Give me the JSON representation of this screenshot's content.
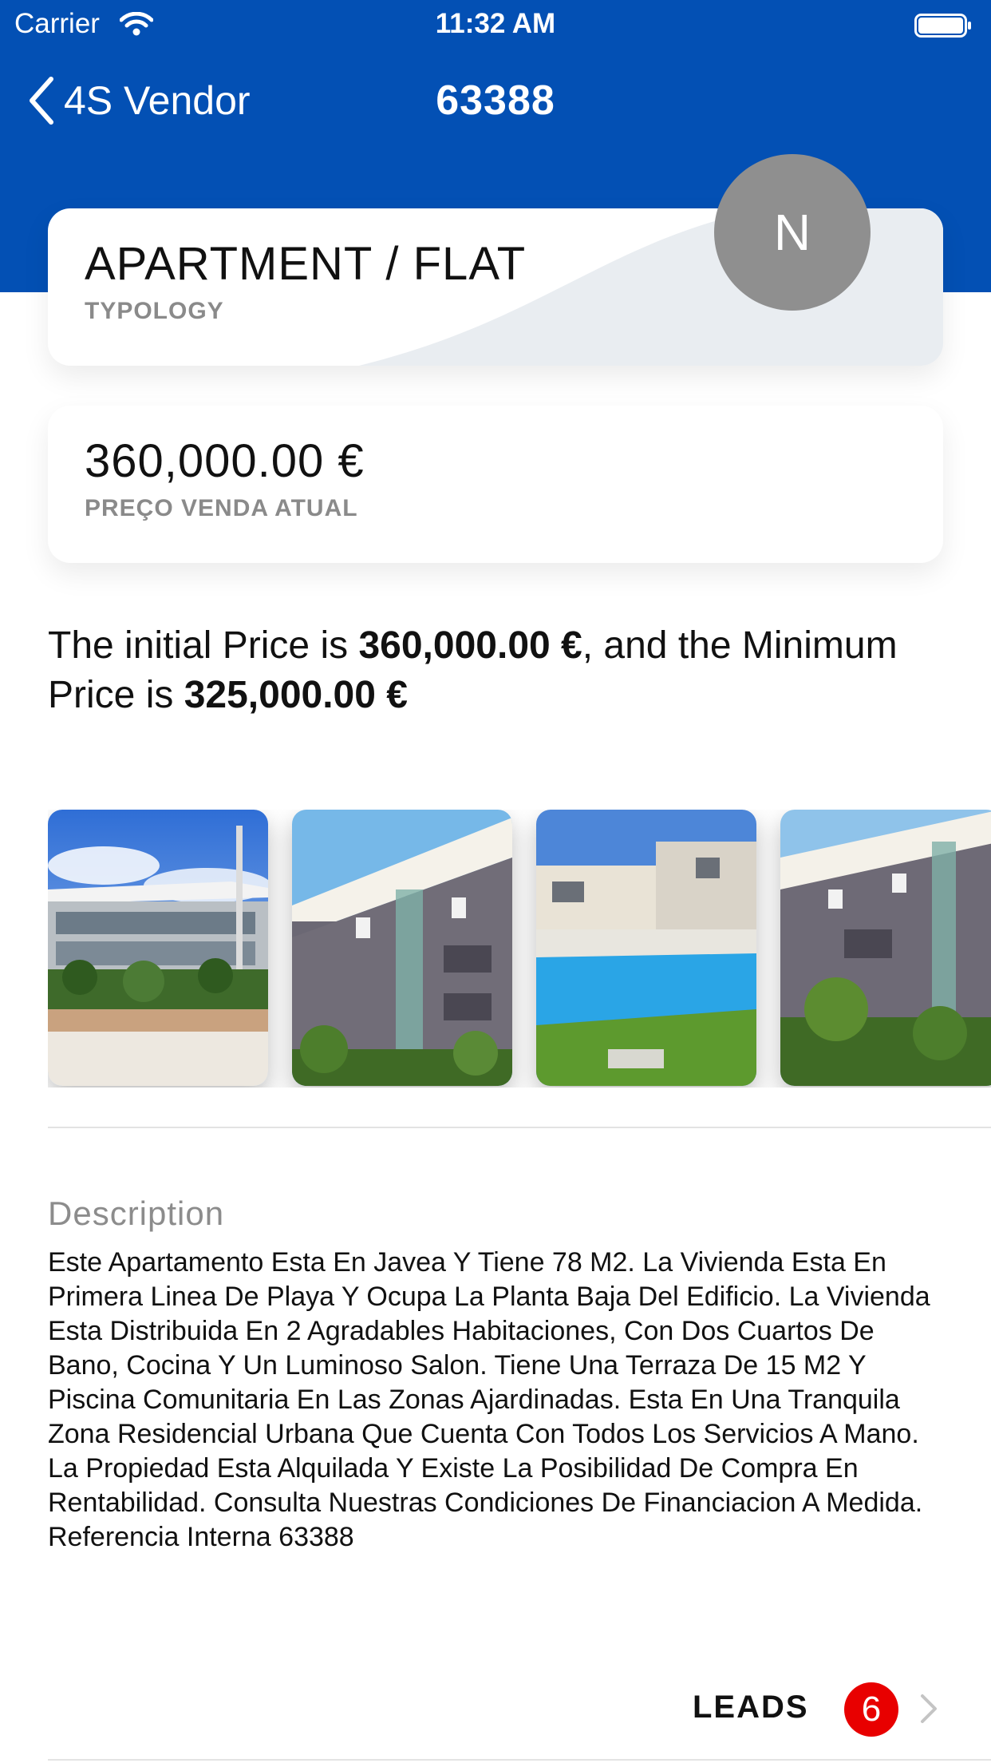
{
  "status_bar": {
    "carrier": "Carrier",
    "time": "11:32 AM"
  },
  "nav": {
    "back_label": "4S Vendor",
    "title": "63388"
  },
  "avatar": {
    "initial": "N"
  },
  "typology": {
    "value": "APARTMENT / FLAT",
    "caption": "TYPOLOGY"
  },
  "price": {
    "value": "360,000.00 €",
    "caption": "PREÇO VENDA ATUAL"
  },
  "price_sentence": {
    "part1": "The initial Price is ",
    "initial": "360,000.00 €",
    "part2": ", and the Minimum Price is ",
    "minimum": "325,000.00 €"
  },
  "gallery": {
    "photos": [
      "building-exterior",
      "building-facade",
      "pool-garden",
      "building-side"
    ]
  },
  "description": {
    "label": "Description",
    "text": "Este Apartamento Esta En Javea Y Tiene 78 M2. La Vivienda Esta En Primera Linea De Playa Y Ocupa La Planta Baja Del Edificio. La Vivienda Esta Distribuida En 2 Agradables Habitaciones, Con Dos Cuartos De Bano, Cocina Y Un Luminoso Salon. Tiene Una Terraza De 15 M2 Y Piscina Comunitaria En Las Zonas Ajardinadas. Esta En Una Tranquila Zona Residencial Urbana Que Cuenta Con Todos Los Servicios A Mano. La Propiedad Esta Alquilada Y Existe La Posibilidad De Compra En Rentabilidad. Consulta Nuestras Condiciones De Financiacion A Medida. Referencia Interna 63388"
  },
  "leads": {
    "label": "LEADS",
    "count": "6"
  },
  "colors": {
    "brand_blue": "#0350b4",
    "badge_red": "#e80000",
    "caption_gray": "#8a8a8a"
  }
}
